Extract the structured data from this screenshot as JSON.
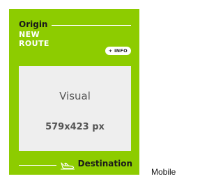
{
  "card": {
    "origin_label": "Origin",
    "title_line1": "NEW",
    "title_line2": "ROUTE",
    "info_button_label": "+ INFO",
    "visual_label": "Visual",
    "visual_size": "579x423 px",
    "destination_label": "Destination",
    "plane_icon": "plane-landing-icon",
    "colors": {
      "card_background": "#8dcc00",
      "title_text": "#ffffff",
      "label_text": "#1a1a1a",
      "visual_placeholder": "#eeeeee"
    }
  },
  "device_label": "Mobile"
}
